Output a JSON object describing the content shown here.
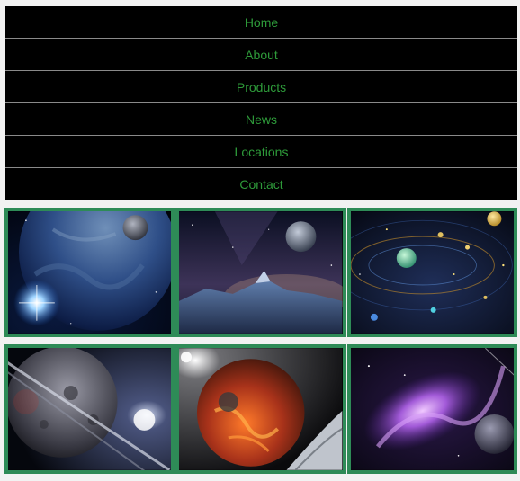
{
  "nav": {
    "items": [
      {
        "label": "Home"
      },
      {
        "label": "About"
      },
      {
        "label": "Products"
      },
      {
        "label": "News"
      },
      {
        "label": "Locations"
      },
      {
        "label": "Contact"
      }
    ]
  },
  "colors": {
    "nav_bg": "#000000",
    "nav_text": "#2e9b3a",
    "nav_divider": "#8a8a8a",
    "tile_border": "#2e8b57",
    "page_bg": "#f2f2f2"
  },
  "gallery": {
    "tiles": [
      {
        "icon": "earth-planet-image"
      },
      {
        "icon": "moon-mountain-image"
      },
      {
        "icon": "solar-system-image"
      },
      {
        "icon": "ringed-planet-image"
      },
      {
        "icon": "fiery-planet-image"
      },
      {
        "icon": "purple-nebula-image"
      }
    ]
  }
}
